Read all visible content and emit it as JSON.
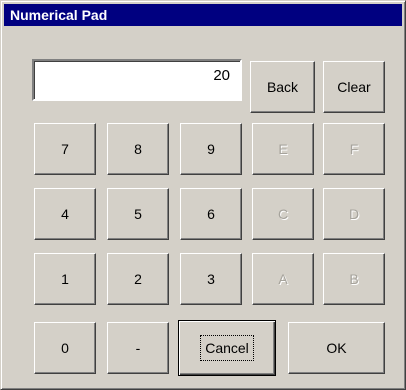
{
  "window": {
    "title": "Numerical Pad"
  },
  "display": {
    "value": "20"
  },
  "controls": {
    "back_label": "Back",
    "clear_label": "Clear"
  },
  "keys": {
    "row1": [
      "7",
      "8",
      "9",
      "E",
      "F"
    ],
    "row2": [
      "4",
      "5",
      "6",
      "C",
      "D"
    ],
    "row3": [
      "1",
      "2",
      "3",
      "A",
      "B"
    ]
  },
  "bottom": {
    "zero_label": "0",
    "minus_label": "-",
    "cancel_label": "Cancel",
    "ok_label": "OK"
  },
  "disabled_keys": [
    "E",
    "F",
    "C",
    "D",
    "A",
    "B"
  ],
  "colors": {
    "titlebar": "#000080",
    "face": "#d4d0c8",
    "disabled_text": "#a6a39c"
  }
}
